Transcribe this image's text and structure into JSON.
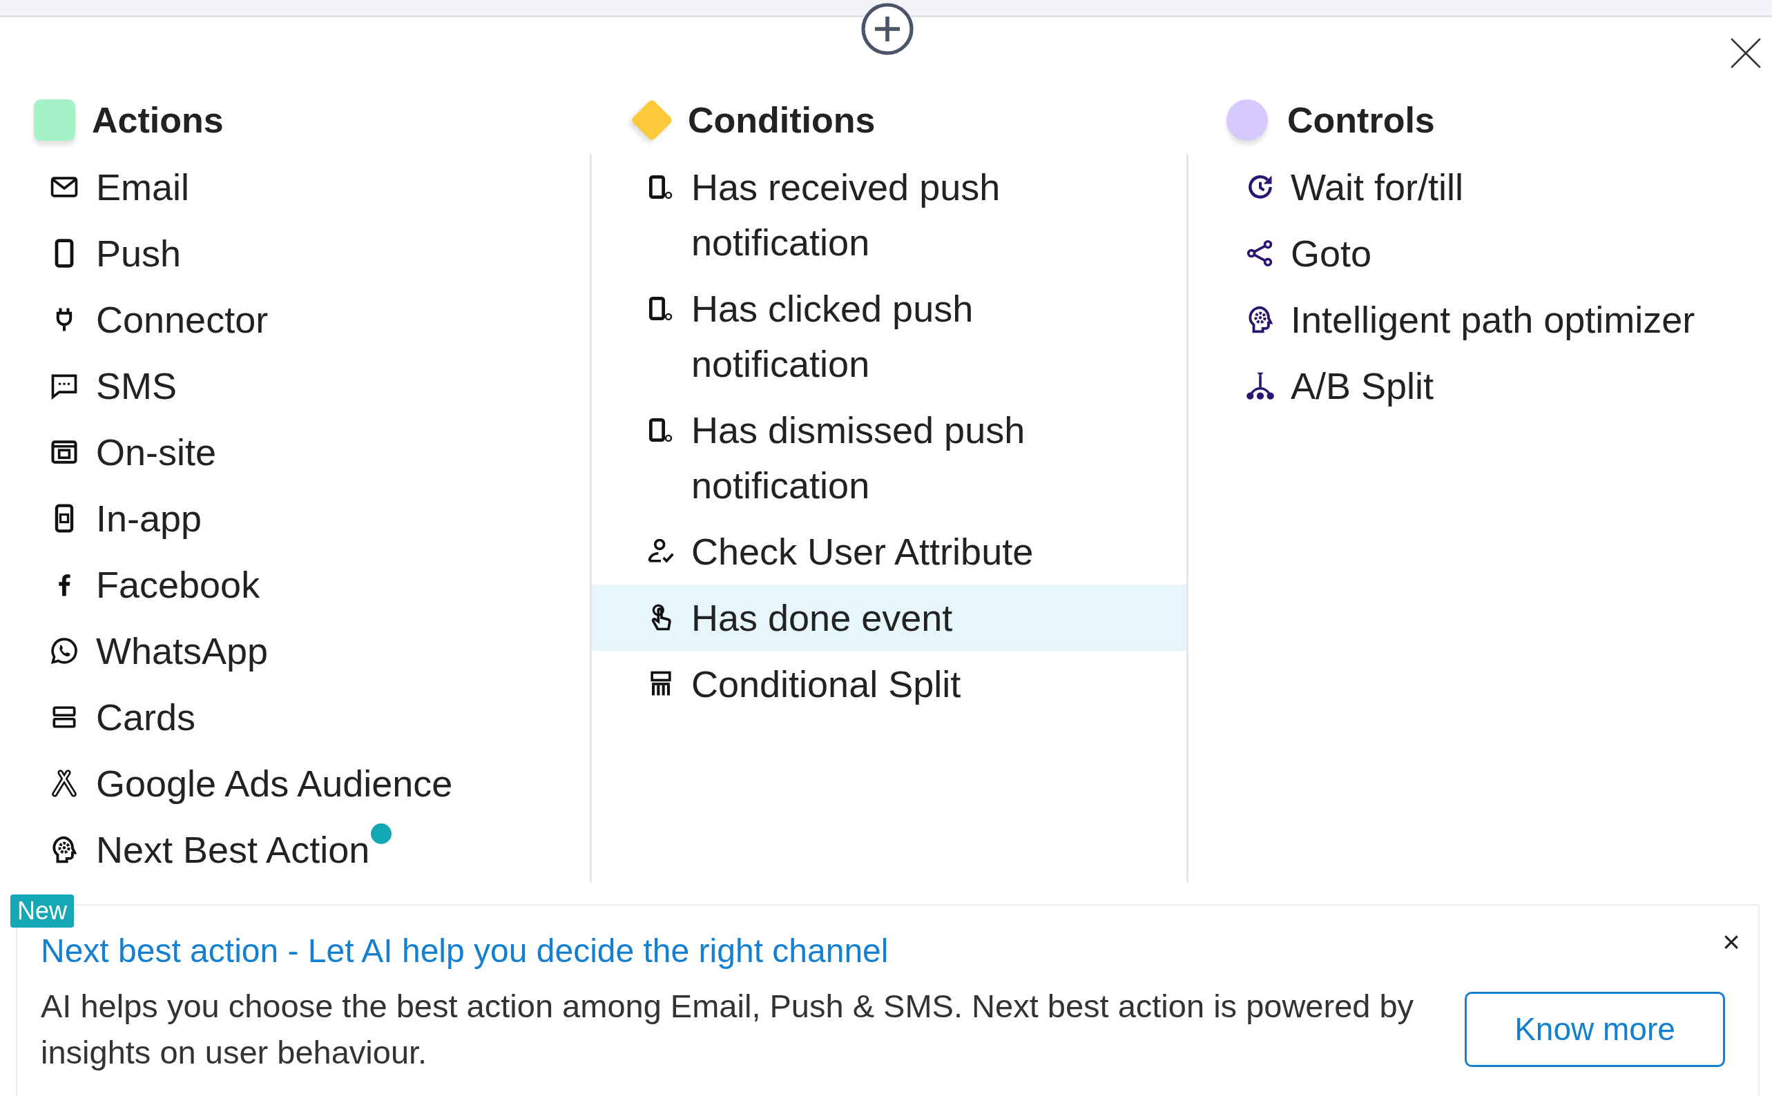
{
  "columns": [
    {
      "title": "Actions",
      "kind": "square",
      "color": "#a6f2c8",
      "items": [
        {
          "label": "Email",
          "kind": "mail",
          "selected": false,
          "dot": false
        },
        {
          "label": "Push",
          "kind": "phone",
          "selected": false,
          "dot": false
        },
        {
          "label": "Connector",
          "kind": "plug",
          "selected": false,
          "dot": false
        },
        {
          "label": "SMS",
          "kind": "chat",
          "selected": false,
          "dot": false
        },
        {
          "label": "On-site",
          "kind": "window",
          "selected": false,
          "dot": false
        },
        {
          "label": "In-app",
          "kind": "phone-window",
          "selected": false,
          "dot": false
        },
        {
          "label": "Facebook",
          "kind": "f-logo",
          "selected": false,
          "dot": false
        },
        {
          "label": "WhatsApp",
          "kind": "phone-bubble",
          "selected": false,
          "dot": false
        },
        {
          "label": "Cards",
          "kind": "cards",
          "selected": false,
          "dot": false
        },
        {
          "label": "Google Ads Audience",
          "kind": "triangle-logo",
          "selected": false,
          "dot": false
        },
        {
          "label": "Next Best Action",
          "kind": "head-gear",
          "selected": false,
          "dot": true
        }
      ]
    },
    {
      "title": "Conditions",
      "kind": "diamond",
      "color": "#fcc93b",
      "items": [
        {
          "label": "Has received push notification",
          "kind": "phone-badge",
          "selected": false,
          "dot": false
        },
        {
          "label": "Has clicked push notification",
          "kind": "phone-badge",
          "selected": false,
          "dot": false
        },
        {
          "label": "Has dismissed push notification",
          "kind": "phone-badge",
          "selected": false,
          "dot": false
        },
        {
          "label": "Check User Attribute",
          "kind": "user-check",
          "selected": false,
          "dot": false
        },
        {
          "label": "Has done event",
          "kind": "tap",
          "selected": true,
          "dot": false
        },
        {
          "label": "Conditional Split",
          "kind": "split-table",
          "selected": false,
          "dot": false
        }
      ]
    },
    {
      "title": "Controls",
      "kind": "circle",
      "color": "#d6c9fc",
      "items": [
        {
          "label": "Wait for/till",
          "kind": "clock-refresh",
          "selected": false,
          "dot": false
        },
        {
          "label": "Goto",
          "kind": "share",
          "selected": false,
          "dot": false
        },
        {
          "label": "Intelligent path optimizer",
          "kind": "head-gear",
          "selected": false,
          "dot": false
        },
        {
          "label": "A/B Split",
          "kind": "tree-split",
          "selected": false,
          "dot": false
        }
      ]
    }
  ],
  "banner": {
    "badge": "New",
    "title": "Next best action - Let AI help you decide the right channel",
    "body": "AI helps you choose the best action among Email, Push & SMS. Next best action is powered by insights on user behaviour.",
    "close": "×",
    "button": "Know more"
  }
}
